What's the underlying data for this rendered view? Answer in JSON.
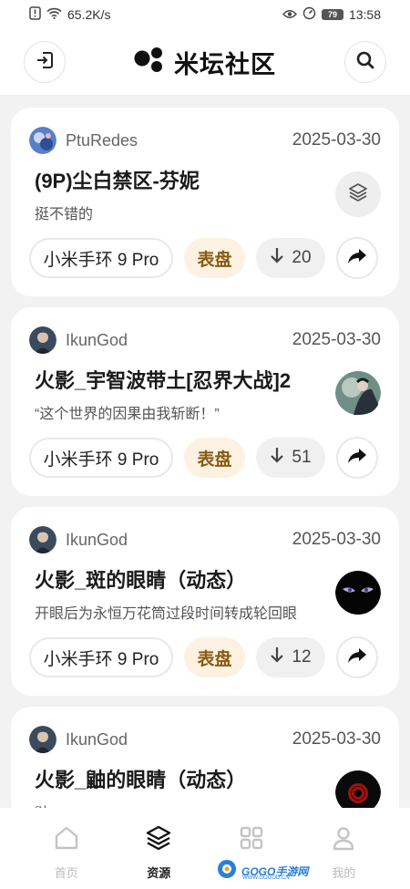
{
  "status_bar": {
    "network_speed": "65.2K/s",
    "battery": "79",
    "time": "13:58"
  },
  "header": {
    "title": "米坛社区",
    "left_icon": "logout-icon",
    "right_icon": "search-icon"
  },
  "posts": [
    {
      "author": "PtuRedes",
      "date": "2025-03-30",
      "title": "(9P)尘白禁区-芬妮",
      "description": "挺不错的",
      "device": "小米手环 9 Pro",
      "category": "表盘",
      "downloads": "20",
      "thumb_icon": "layers-icon"
    },
    {
      "author": "IkunGod",
      "date": "2025-03-30",
      "title": "火影_宇智波带土[忍界大战]2",
      "description": "“这个世界的因果由我斩断！”",
      "device": "小米手环 9 Pro",
      "category": "表盘",
      "downloads": "51",
      "thumb_icon": "obito-thumbnail"
    },
    {
      "author": "IkunGod",
      "date": "2025-03-30",
      "title": "火影_斑的眼睛（动态）",
      "description": "开眼后为永恒万花筒过段时间转成轮回眼",
      "device": "小米手环 9 Pro",
      "category": "表盘",
      "downloads": "12",
      "thumb_icon": "madara-eyes-thumbnail"
    },
    {
      "author": "IkunGod",
      "date": "2025-03-30",
      "title": "火影_鼬的眼睛（动态）",
      "description": "鼬",
      "device": "",
      "category": "",
      "downloads": "",
      "thumb_icon": "itachi-eye-thumbnail"
    }
  ],
  "bottom_nav": [
    {
      "label": "首页",
      "icon": "home-icon",
      "active": false
    },
    {
      "label": "资源",
      "icon": "layers-icon",
      "active": true
    },
    {
      "label": "",
      "icon": "grid-icon",
      "active": false
    },
    {
      "label": "我的",
      "icon": "user-icon",
      "active": false
    }
  ],
  "watermark": {
    "text": "GOGO手游网",
    "sub": "WWW.GOGOD.CN"
  },
  "colors": {
    "category_bg": "#fdf2e2",
    "category_text": "#8a5a12",
    "page_bg": "#f2f2f2"
  }
}
